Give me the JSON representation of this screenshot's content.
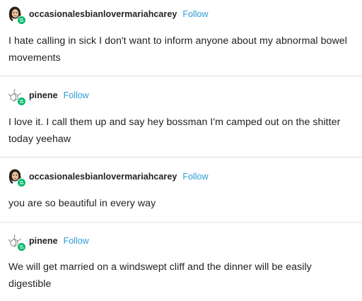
{
  "posts": [
    {
      "username": "occasionalesbianlovermariahcarey",
      "follow_label": "Follow",
      "avatar_icon": "woman-portrait-avatar-icon",
      "badge_icon": "reblog-badge-icon",
      "text": "I hate calling in sick I don't want to inform anyone about my abnormal bowel movements"
    },
    {
      "username": "pinene",
      "follow_label": "Follow",
      "avatar_icon": "molecule-avatar-icon",
      "badge_icon": "reblog-badge-icon",
      "text": "I love it. I call them up and say hey bossman I'm camped out on the shitter today yeehaw"
    },
    {
      "username": "occasionalesbianlovermariahcarey",
      "follow_label": "Follow",
      "avatar_icon": "woman-portrait-avatar-icon",
      "badge_icon": "reblog-badge-icon",
      "text": "you are so beautiful in every way"
    },
    {
      "username": "pinene",
      "follow_label": "Follow",
      "avatar_icon": "molecule-avatar-icon",
      "badge_icon": "reblog-badge-icon",
      "text": "We will get married on a windswept cliff and the dinner will be easily digestible"
    }
  ],
  "colors": {
    "follow": "#2e9bd6",
    "badge": "#00b869",
    "divider": "#e2e2e2",
    "text": "#222222"
  }
}
